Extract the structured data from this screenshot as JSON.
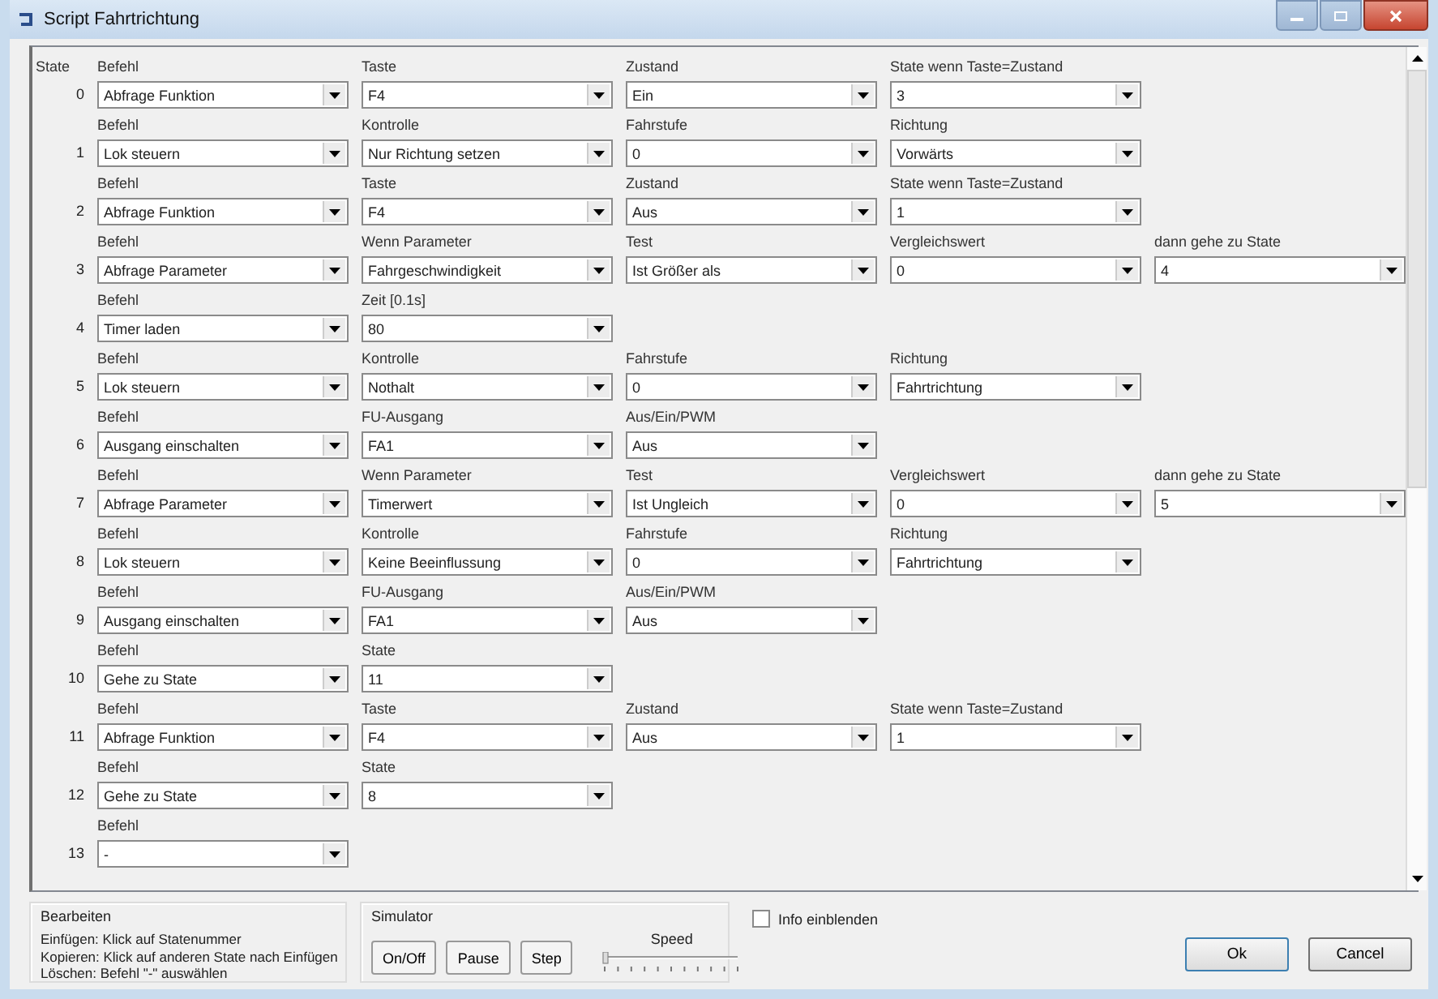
{
  "window": {
    "title": "Script Fahrtrichtung"
  },
  "state_header": "State",
  "rows": [
    {
      "state": "0",
      "fields": [
        {
          "label": "Befehl",
          "value": "Abfrage Funktion"
        },
        {
          "label": "Taste",
          "value": "F4"
        },
        {
          "label": "Zustand",
          "value": "Ein"
        },
        {
          "label": "State wenn Taste=Zustand",
          "value": "3"
        }
      ]
    },
    {
      "state": "1",
      "fields": [
        {
          "label": "Befehl",
          "value": "Lok steuern"
        },
        {
          "label": "Kontrolle",
          "value": "Nur Richtung setzen"
        },
        {
          "label": "Fahrstufe",
          "value": "0"
        },
        {
          "label": "Richtung",
          "value": "Vorwärts"
        }
      ]
    },
    {
      "state": "2",
      "fields": [
        {
          "label": "Befehl",
          "value": "Abfrage Funktion"
        },
        {
          "label": "Taste",
          "value": "F4"
        },
        {
          "label": "Zustand",
          "value": "Aus"
        },
        {
          "label": "State wenn Taste=Zustand",
          "value": "1"
        }
      ]
    },
    {
      "state": "3",
      "fields": [
        {
          "label": "Befehl",
          "value": "Abfrage Parameter"
        },
        {
          "label": "Wenn Parameter",
          "value": "Fahrgeschwindigkeit"
        },
        {
          "label": "Test",
          "value": "Ist Größer als"
        },
        {
          "label": "Vergleichswert",
          "value": "0"
        },
        {
          "label": "dann gehe zu State",
          "value": "4"
        }
      ]
    },
    {
      "state": "4",
      "fields": [
        {
          "label": "Befehl",
          "value": "Timer laden"
        },
        {
          "label": "Zeit [0.1s]",
          "value": "80"
        }
      ]
    },
    {
      "state": "5",
      "fields": [
        {
          "label": "Befehl",
          "value": "Lok steuern"
        },
        {
          "label": "Kontrolle",
          "value": "Nothalt"
        },
        {
          "label": "Fahrstufe",
          "value": "0"
        },
        {
          "label": "Richtung",
          "value": "Fahrtrichtung"
        }
      ]
    },
    {
      "state": "6",
      "fields": [
        {
          "label": "Befehl",
          "value": "Ausgang einschalten"
        },
        {
          "label": "FU-Ausgang",
          "value": "FA1"
        },
        {
          "label": "Aus/Ein/PWM",
          "value": "Aus"
        }
      ]
    },
    {
      "state": "7",
      "fields": [
        {
          "label": "Befehl",
          "value": "Abfrage Parameter"
        },
        {
          "label": "Wenn Parameter",
          "value": "Timerwert"
        },
        {
          "label": "Test",
          "value": "Ist Ungleich"
        },
        {
          "label": "Vergleichswert",
          "value": "0"
        },
        {
          "label": "dann gehe zu State",
          "value": "5"
        }
      ]
    },
    {
      "state": "8",
      "fields": [
        {
          "label": "Befehl",
          "value": "Lok steuern"
        },
        {
          "label": "Kontrolle",
          "value": "Keine Beeinflussung"
        },
        {
          "label": "Fahrstufe",
          "value": "0"
        },
        {
          "label": "Richtung",
          "value": "Fahrtrichtung"
        }
      ]
    },
    {
      "state": "9",
      "fields": [
        {
          "label": "Befehl",
          "value": "Ausgang einschalten"
        },
        {
          "label": "FU-Ausgang",
          "value": "FA1"
        },
        {
          "label": "Aus/Ein/PWM",
          "value": "Aus"
        }
      ]
    },
    {
      "state": "10",
      "fields": [
        {
          "label": "Befehl",
          "value": "Gehe zu State"
        },
        {
          "label": "State",
          "value": "11"
        }
      ]
    },
    {
      "state": "11",
      "fields": [
        {
          "label": "Befehl",
          "value": "Abfrage Funktion"
        },
        {
          "label": "Taste",
          "value": "F4"
        },
        {
          "label": "Zustand",
          "value": "Aus"
        },
        {
          "label": "State wenn Taste=Zustand",
          "value": "1"
        }
      ]
    },
    {
      "state": "12",
      "fields": [
        {
          "label": "Befehl",
          "value": "Gehe zu State"
        },
        {
          "label": "State",
          "value": "8"
        }
      ]
    },
    {
      "state": "13",
      "fields": [
        {
          "label": "Befehl",
          "value": "-"
        }
      ]
    }
  ],
  "edit_group": {
    "title": "Bearbeiten",
    "lines": [
      "Einfügen: Klick auf Statenummer",
      "Kopieren: Klick auf anderen State nach Einfügen",
      "Löschen: Befehl \"-\" auswählen"
    ]
  },
  "simulator": {
    "title": "Simulator",
    "buttons": [
      "On/Off",
      "Pause",
      "Step"
    ],
    "speed_label": "Speed",
    "speed_slider": {
      "level": 0
    }
  },
  "info_checkbox": {
    "label": "Info einblenden",
    "checked": false
  },
  "buttons": [
    "Ok",
    "Cancel"
  ]
}
